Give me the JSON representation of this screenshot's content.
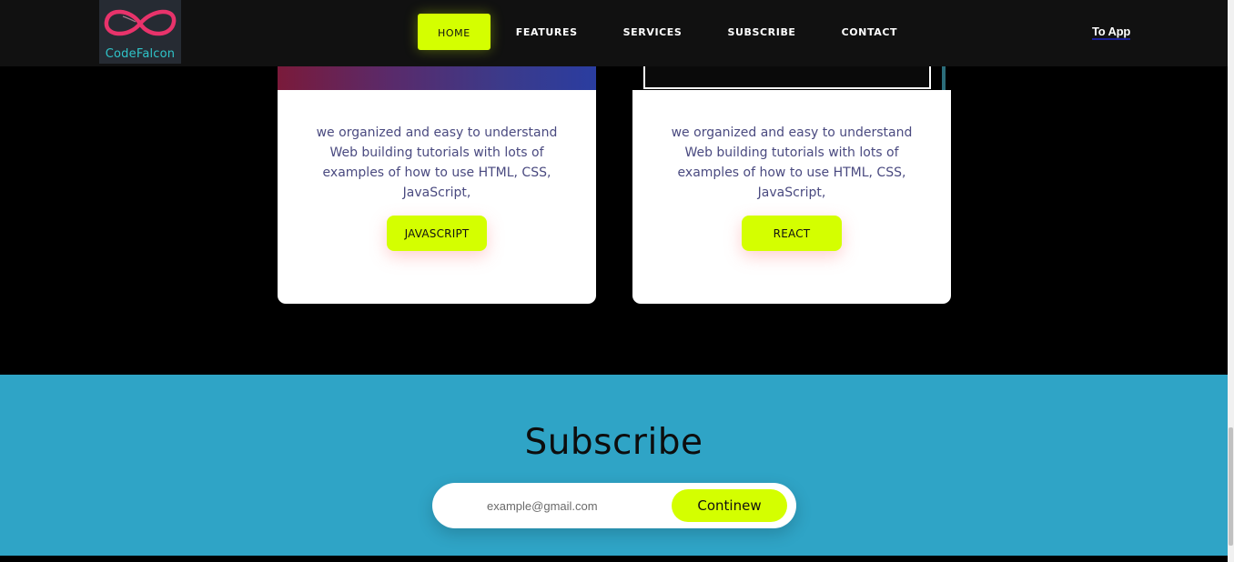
{
  "navbar": {
    "logo_text": "CodeFalcon",
    "links": [
      {
        "label": "HOME",
        "active": true
      },
      {
        "label": "FEATURES",
        "active": false
      },
      {
        "label": "SERVICES",
        "active": false
      },
      {
        "label": "SUBSCRIBE",
        "active": false
      },
      {
        "label": "CONTACT",
        "active": false
      }
    ],
    "to_app_label": "To App"
  },
  "cards": [
    {
      "text": "we organized and easy to understand Web building tutorials with lots of examples of how to use HTML, CSS, JavaScript,",
      "button_label": "JAVASCRIPT"
    },
    {
      "text": "we organized and easy to understand Web building tutorials with lots of examples of how to use HTML, CSS, JavaScript,",
      "button_label": "REACT"
    }
  ],
  "subscribe": {
    "title": "Subscribe",
    "email_placeholder": "example@gmail.com",
    "button_label": "Continew"
  },
  "colors": {
    "accent": "#d4ff00",
    "navbar_bg": "#111111",
    "subscribe_bg": "#2fa4c6",
    "logo_pink": "#e8336b",
    "logo_teal": "#2fc4c9"
  },
  "icons": {
    "logo": "infinity-logo-icon"
  }
}
